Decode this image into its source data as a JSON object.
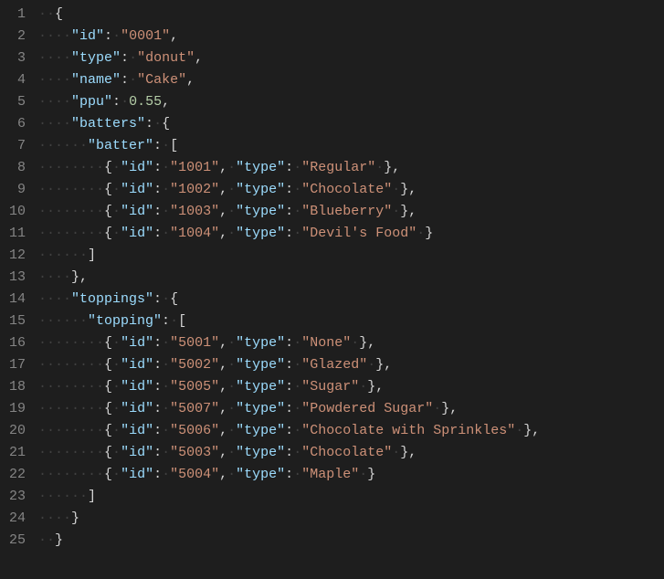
{
  "lineCount": 25,
  "code": {
    "id": {
      "key": "id",
      "value": "0001"
    },
    "type": {
      "key": "type",
      "value": "donut"
    },
    "name": {
      "key": "name",
      "value": "Cake"
    },
    "ppu": {
      "key": "ppu",
      "value": "0.55"
    },
    "batters": {
      "key": "batters",
      "childKey": "batter",
      "items": [
        {
          "id": "1001",
          "type": "Regular"
        },
        {
          "id": "1002",
          "type": "Chocolate"
        },
        {
          "id": "1003",
          "type": "Blueberry"
        },
        {
          "id": "1004",
          "type": "Devil's Food"
        }
      ]
    },
    "toppings": {
      "key": "toppings",
      "childKey": "topping",
      "items": [
        {
          "id": "5001",
          "type": "None"
        },
        {
          "id": "5002",
          "type": "Glazed"
        },
        {
          "id": "5005",
          "type": "Sugar"
        },
        {
          "id": "5007",
          "type": "Powdered Sugar"
        },
        {
          "id": "5006",
          "type": "Chocolate with Sprinkles"
        },
        {
          "id": "5003",
          "type": "Chocolate"
        },
        {
          "id": "5004",
          "type": "Maple"
        }
      ]
    },
    "labels": {
      "idKey": "id",
      "typeKey": "type"
    }
  }
}
